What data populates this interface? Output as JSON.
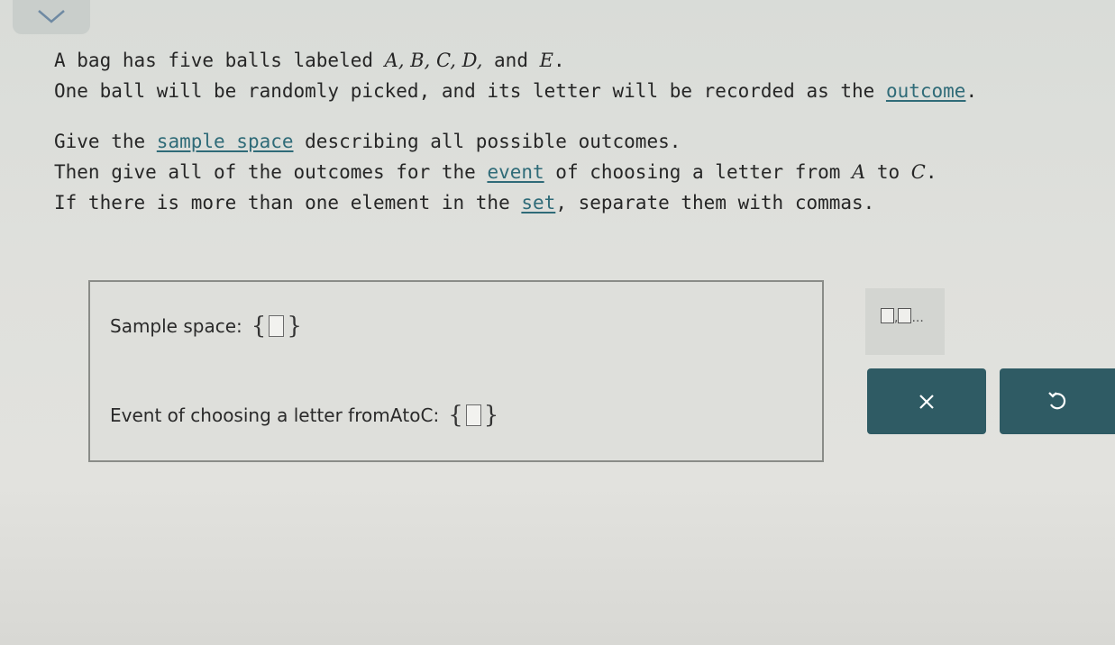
{
  "problem": {
    "line1": {
      "t1": "A bag has five balls labeled ",
      "m1": "A, B, C, D,",
      "t2": " and ",
      "m2": "E",
      "t3": "."
    },
    "line2": {
      "t1": "One ball will be randomly picked, and its letter will be recorded as the ",
      "link": "outcome",
      "t2": "."
    },
    "line3": {
      "t1": "Give the ",
      "link": "sample space",
      "t2": " describing all possible outcomes."
    },
    "line4": {
      "t1": "Then give all of the outcomes for the ",
      "link": "event",
      "t2": " of choosing a letter from ",
      "m1": "A",
      "t3": " to ",
      "m2": "C",
      "t4": "."
    },
    "line5": {
      "t1": "If there is more than one element in the ",
      "link": "set",
      "t2": ", separate them with commas."
    }
  },
  "answers": {
    "sample_space": {
      "label": "Sample space: ",
      "open": "{",
      "close": "}",
      "value": ""
    },
    "event": {
      "t1": "Event of choosing a letter from ",
      "v1": "A",
      "t2": " to ",
      "v2": "C",
      "t3": " : ",
      "open": "{",
      "close": "}",
      "value": ""
    }
  },
  "palette": {
    "separator": ",",
    "ellipsis": "..."
  },
  "colors": {
    "button": "#2f5b64",
    "term_link": "#2f6b78"
  },
  "icons": [
    "chevron-down-icon",
    "set-template-icon",
    "close-icon",
    "undo-icon"
  ]
}
